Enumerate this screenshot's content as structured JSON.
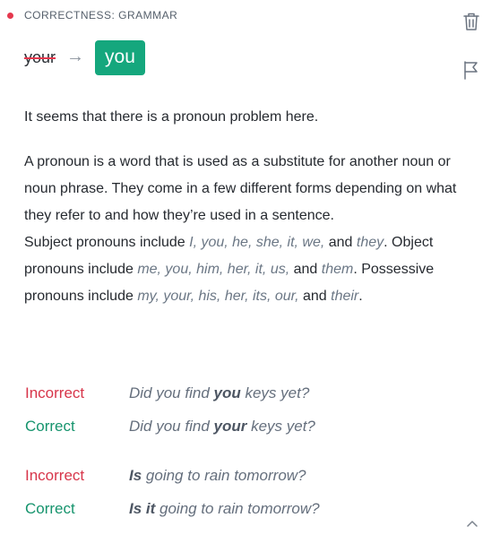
{
  "header": {
    "category": "CORRECTNESS: GRAMMAR",
    "dot_color": "#e5384e"
  },
  "suggestion": {
    "original": "your",
    "replacement": "you",
    "arrow": "→"
  },
  "actions": {
    "trash_icon": "trash-icon",
    "flag_icon": "flag-icon",
    "collapse_icon": "chevron-up-icon"
  },
  "content": {
    "intro": "It seems that there is a pronoun problem here.",
    "p1": "A pronoun is a word that is used as a substitute for another noun or noun phrase. They come in a few different forms depending on what they refer to and how they’re used in a sentence.",
    "subject_prefix": "Subject pronouns include ",
    "subject_examples": "I, you, he, she, it, we,",
    "subject_and": " and ",
    "subject_last": "they",
    "object_prefix": ". Object pronouns include ",
    "object_examples": "me, you, him, her, it, us,",
    "object_and": " and ",
    "object_last": "them",
    "possessive_prefix": ". Possessive pronouns include ",
    "possessive_examples": "my, your, his, her, its, our,",
    "possessive_and": " and ",
    "possessive_last": "their",
    "end": "."
  },
  "examples": [
    {
      "incorrect_label": "Incorrect",
      "incorrect_parts": [
        "Did you find ",
        "you",
        " keys yet?"
      ],
      "correct_label": "Correct",
      "correct_parts": [
        "Did you find ",
        "your",
        " keys yet?"
      ]
    },
    {
      "incorrect_label": "Incorrect",
      "incorrect_parts": [
        "",
        "Is",
        " going to rain tomorrow?"
      ],
      "correct_label": "Correct",
      "correct_parts": [
        "",
        "Is it",
        " going to rain tomorrow?"
      ]
    }
  ]
}
